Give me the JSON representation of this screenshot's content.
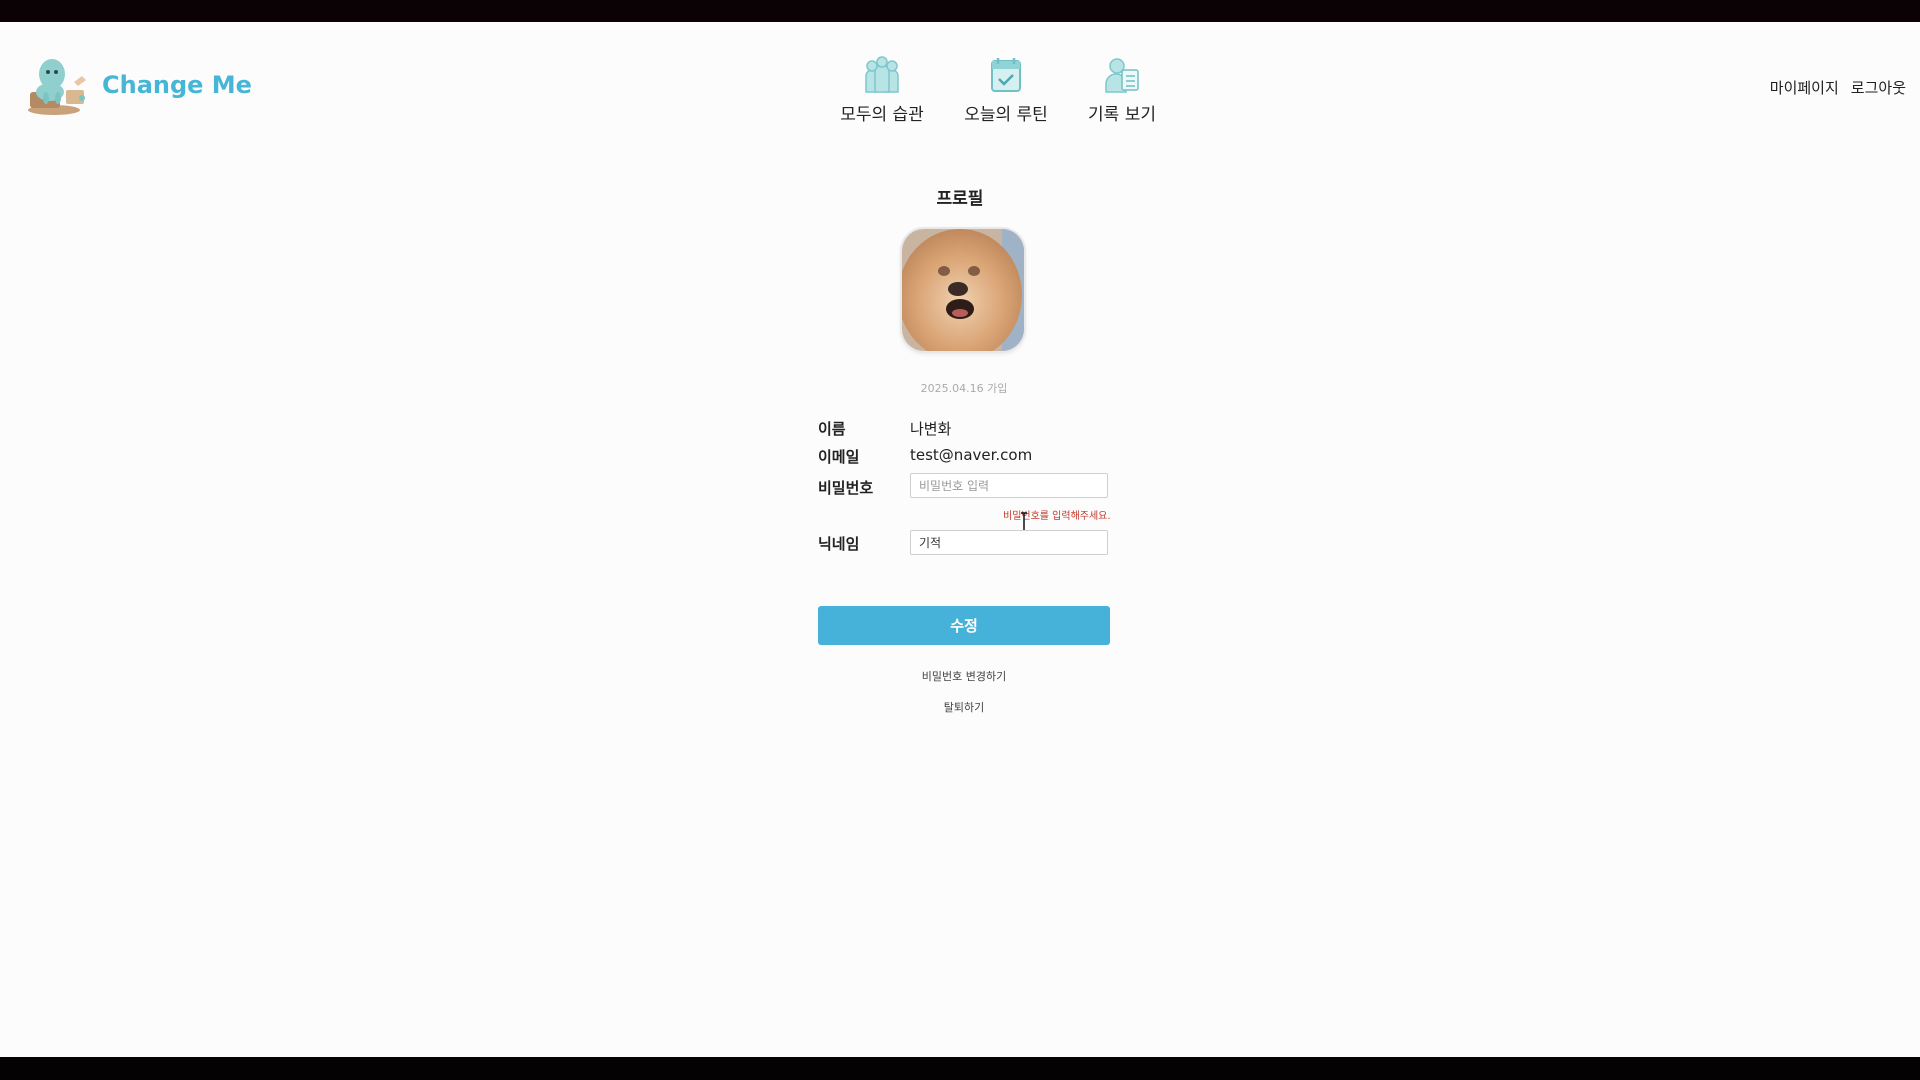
{
  "brand": {
    "name": "Change Me"
  },
  "nav": [
    {
      "label": "모두의 습관",
      "icon": "people-icon"
    },
    {
      "label": "오늘의 루틴",
      "icon": "calendar-check-icon"
    },
    {
      "label": "기록 보기",
      "icon": "person-list-icon"
    }
  ],
  "user_links": {
    "mypage": "마이페이지",
    "logout": "로그아웃"
  },
  "profile": {
    "title": "프로필",
    "join_date": "2025.04.16 가입",
    "name_label": "이름",
    "name_value": "나변화",
    "email_label": "이메일",
    "email_value": "test@naver.com",
    "password_label": "비밀번호",
    "password_placeholder": "비밀번호 입력",
    "password_hint": "비밀번호를 입력해주세요.",
    "nickname_label": "닉네임",
    "nickname_value": "기적",
    "submit_label": "수정",
    "change_password": "비밀번호 변경하기",
    "withdraw": "탈퇴하기"
  },
  "colors": {
    "accent": "#47b2d9",
    "brand": "#47b6d6",
    "error": "#c0392b"
  }
}
